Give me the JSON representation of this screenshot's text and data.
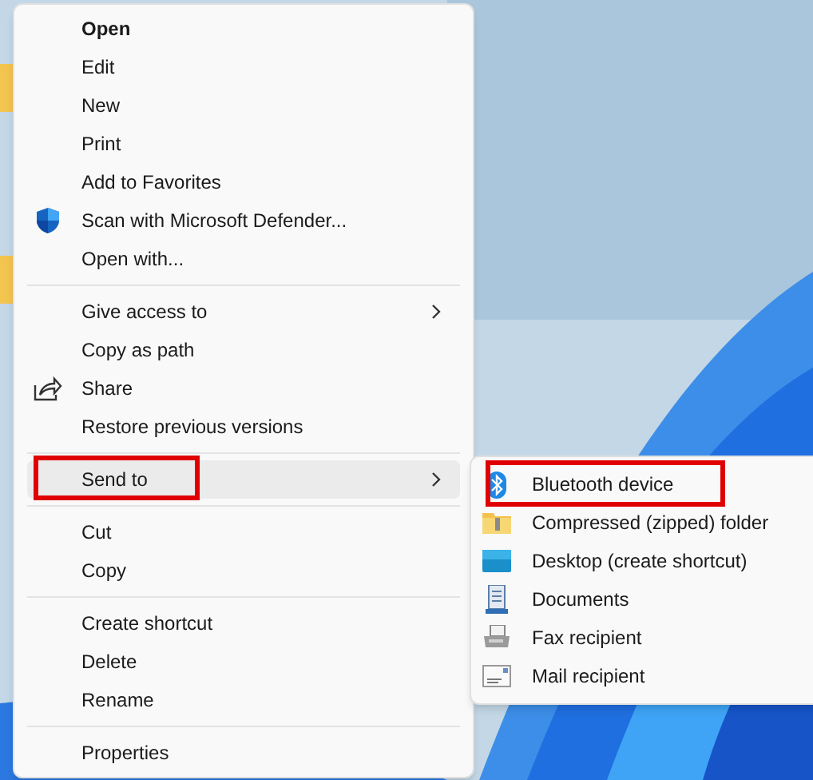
{
  "context_menu": {
    "groups": [
      [
        {
          "label": "Open",
          "kind": "plain",
          "bold": true,
          "has_submenu": false,
          "selected": false,
          "annotated": false
        },
        {
          "label": "Edit",
          "kind": "plain",
          "bold": false,
          "has_submenu": false,
          "selected": false,
          "annotated": false
        },
        {
          "label": "New",
          "kind": "plain",
          "bold": false,
          "has_submenu": false,
          "selected": false,
          "annotated": false
        },
        {
          "label": "Print",
          "kind": "plain",
          "bold": false,
          "has_submenu": false,
          "selected": false,
          "annotated": false
        },
        {
          "label": "Add to Favorites",
          "kind": "plain",
          "bold": false,
          "has_submenu": false,
          "selected": false,
          "annotated": false
        },
        {
          "label": "Scan with Microsoft Defender...",
          "kind": "shield",
          "bold": false,
          "has_submenu": false,
          "selected": false,
          "annotated": false
        },
        {
          "label": "Open with...",
          "kind": "plain",
          "bold": false,
          "has_submenu": false,
          "selected": false,
          "annotated": false
        }
      ],
      [
        {
          "label": "Give access to",
          "kind": "plain",
          "bold": false,
          "has_submenu": true,
          "selected": false,
          "annotated": false
        },
        {
          "label": "Copy as path",
          "kind": "plain",
          "bold": false,
          "has_submenu": false,
          "selected": false,
          "annotated": false
        },
        {
          "label": "Share",
          "kind": "share",
          "bold": false,
          "has_submenu": false,
          "selected": false,
          "annotated": false
        },
        {
          "label": "Restore previous versions",
          "kind": "plain",
          "bold": false,
          "has_submenu": false,
          "selected": false,
          "annotated": false
        }
      ],
      [
        {
          "label": "Send to",
          "kind": "plain",
          "bold": false,
          "has_submenu": true,
          "selected": true,
          "annotated": true
        }
      ],
      [
        {
          "label": "Cut",
          "kind": "plain",
          "bold": false,
          "has_submenu": false,
          "selected": false,
          "annotated": false
        },
        {
          "label": "Copy",
          "kind": "plain",
          "bold": false,
          "has_submenu": false,
          "selected": false,
          "annotated": false
        }
      ],
      [
        {
          "label": "Create shortcut",
          "kind": "plain",
          "bold": false,
          "has_submenu": false,
          "selected": false,
          "annotated": false
        },
        {
          "label": "Delete",
          "kind": "plain",
          "bold": false,
          "has_submenu": false,
          "selected": false,
          "annotated": false
        },
        {
          "label": "Rename",
          "kind": "plain",
          "bold": false,
          "has_submenu": false,
          "selected": false,
          "annotated": false
        }
      ],
      [
        {
          "label": "Properties",
          "kind": "plain",
          "bold": false,
          "has_submenu": false,
          "selected": false,
          "annotated": false
        }
      ]
    ]
  },
  "send_to_menu": {
    "items": [
      {
        "label": "Bluetooth device",
        "kind": "bluetooth",
        "selected": false,
        "annotated": true
      },
      {
        "label": "Compressed (zipped) folder",
        "kind": "zip",
        "selected": false,
        "annotated": false
      },
      {
        "label": "Desktop (create shortcut)",
        "kind": "desktop",
        "selected": false,
        "annotated": false
      },
      {
        "label": "Documents",
        "kind": "documents",
        "selected": false,
        "annotated": false
      },
      {
        "label": "Fax recipient",
        "kind": "fax",
        "selected": false,
        "annotated": false
      },
      {
        "label": "Mail recipient",
        "kind": "mail",
        "selected": false,
        "annotated": false
      }
    ]
  }
}
